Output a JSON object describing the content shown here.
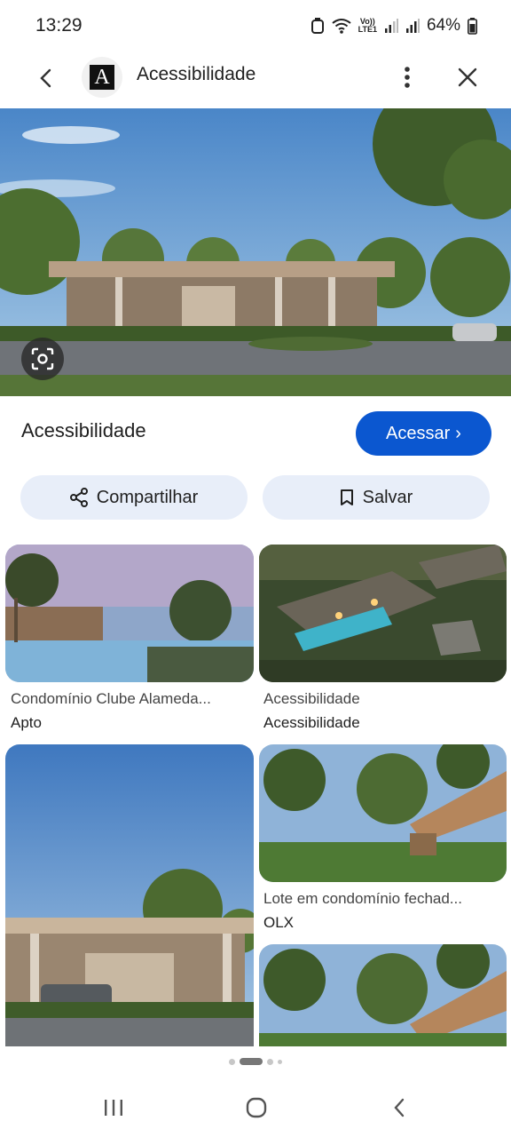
{
  "status_bar": {
    "time": "13:29",
    "volte_top": "Vo))",
    "volte_bottom": "LTE1",
    "battery": "64%"
  },
  "app_bar": {
    "title": "Acessibilidade",
    "logo_letter": "A"
  },
  "result": {
    "title": "Acessibilidade",
    "visit_label": "Acessar",
    "visit_chevron": "›",
    "share_label": "Compartilhar",
    "save_label": "Salvar"
  },
  "grid": [
    {
      "title": "Condomínio Clube Alameda...",
      "source": "Apto"
    },
    {
      "title": "Acessibilidade",
      "source": "Acessibilidade"
    },
    {
      "title": "Lote em condomínio fechad...",
      "source": "OLX"
    }
  ],
  "colors": {
    "accent": "#0b57d0",
    "pill_bg": "#e8eef9"
  },
  "icons": [
    "back-arrow-icon",
    "site-logo",
    "more-vert-icon",
    "close-icon",
    "lens-icon",
    "share-icon",
    "bookmark-icon",
    "recents-icon",
    "home-icon",
    "nav-back-icon"
  ]
}
